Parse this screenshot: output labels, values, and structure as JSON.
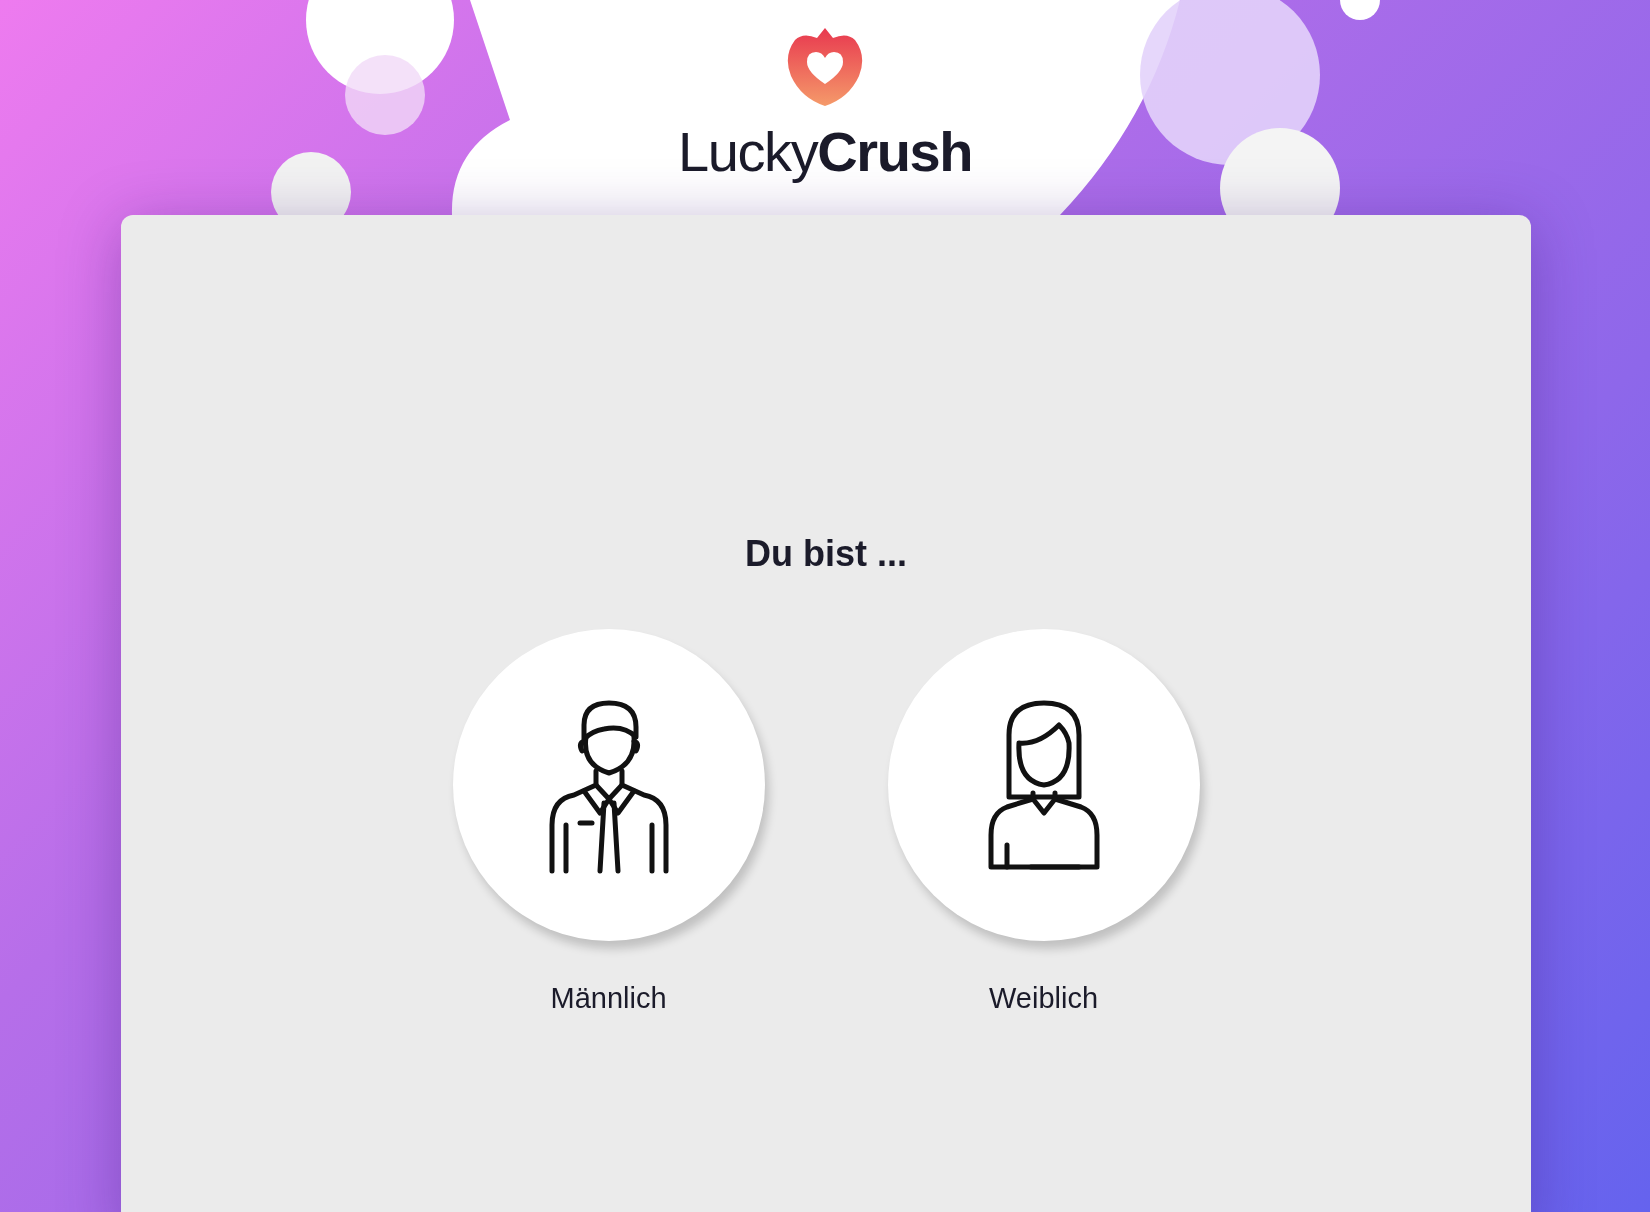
{
  "logo": {
    "wordmark": "Lucky**Crush**"
  },
  "heading": "Du bist ...",
  "options": [
    {
      "kind": "male",
      "label": "Männlich",
      "selected": false
    },
    {
      "kind": "female",
      "label": "Weiblich",
      "selected": false
    }
  ]
}
